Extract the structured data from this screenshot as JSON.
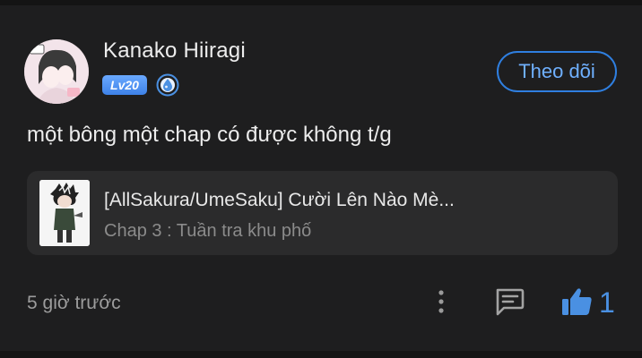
{
  "comment": {
    "user": {
      "name": "Kanako Hiiragi",
      "level": "Lv20",
      "avatar_icon": "avatar-image",
      "rank_icon": "water-drop-icon"
    },
    "follow_label": "Theo dõi",
    "text": "một bông một chap có được không t/g",
    "chapter": {
      "title": "[AllSakura/UmeSaku] Cười Lên Nào Mè...",
      "subtitle": "Chap 3 : Tuần tra khu phố",
      "thumbnail_icon": "manga-cover-thumbnail"
    },
    "timestamp": "5 giờ trước",
    "actions": {
      "more_icon": "more-vertical-icon",
      "reply_icon": "comment-icon",
      "like_icon": "thumbs-up-icon",
      "like_count": "1"
    }
  },
  "colors": {
    "background": "#1e1e1f",
    "card": "#2b2b2c",
    "accent": "#3e82e8",
    "text": "#ececec",
    "muted": "#9c9c9c"
  }
}
